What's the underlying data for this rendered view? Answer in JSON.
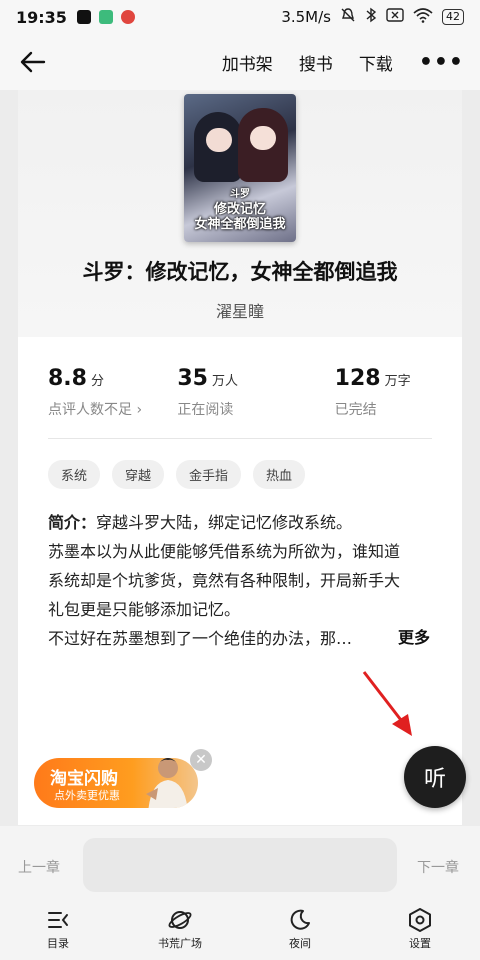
{
  "status_bar": {
    "time": "19:35",
    "net_speed": "3.5M/s",
    "battery": "42"
  },
  "top_nav": {
    "add_shelf": "加书架",
    "search_book": "搜书",
    "download": "下载"
  },
  "book": {
    "cover_text_line1": "斗罗",
    "cover_text_line2": "修改记忆",
    "cover_text_line3": "女神全都倒追我",
    "title": "斗罗：修改记忆，女神全都倒追我",
    "author": "濯星瞳"
  },
  "stats": [
    {
      "value": "8.8",
      "unit": "分",
      "sub": "点评人数不足 ›"
    },
    {
      "value": "35",
      "unit": "万人",
      "sub": "正在阅读"
    },
    {
      "value": "128",
      "unit": "万字",
      "sub": "已完结"
    }
  ],
  "tags": [
    "系统",
    "穿越",
    "金手指",
    "热血"
  ],
  "intro": {
    "label": "简介：",
    "line1": "穿越斗罗大陆，绑定记忆修改系统。",
    "line2": "苏墨本以为从此便能够凭借系统为所欲为，谁知道",
    "line3": "系统却是个坑爹货，竟然有各种限制，开局新手大",
    "line4": "礼包更是只能够添加记忆。",
    "line5": "不过好在苏墨想到了一个绝佳的办法，那…",
    "more": "更多"
  },
  "listen_label": "听",
  "ad": {
    "title": "淘宝闪购",
    "subtitle": "点外卖更优惠"
  },
  "chapter_bar": {
    "prev": "上一章",
    "next": "下一章"
  },
  "bottom_nav": {
    "catalog": "目录",
    "bookstore": "书荒广场",
    "night": "夜间",
    "settings": "设置"
  }
}
